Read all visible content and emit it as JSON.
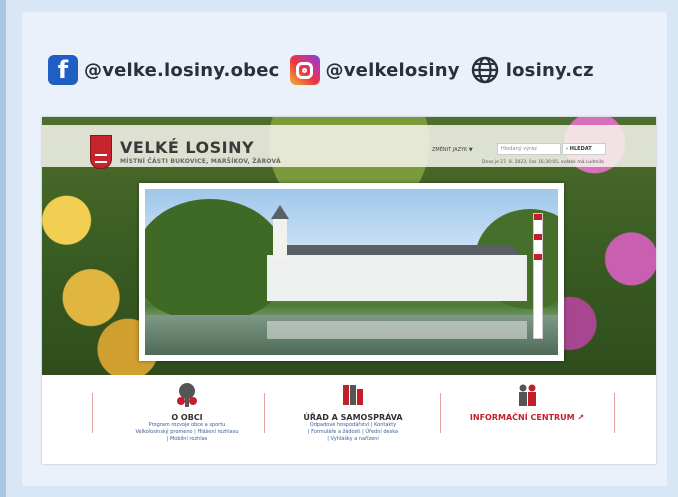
{
  "social": {
    "facebook": {
      "icon": "facebook-icon",
      "handle": "@velke.losiny.obec",
      "color": "#1f5fc4"
    },
    "instagram": {
      "icon": "instagram-icon",
      "handle": "@velkelosiny"
    },
    "web": {
      "icon": "globe-icon",
      "handle": "losiny.cz"
    }
  },
  "site": {
    "title": "VELKÉ LOSINY",
    "subtitle": "MÍSTNÍ ČÁSTI BUKOVICE, MARŠÍKOV, ŽÁROVÁ",
    "language": "ZMĚNIT JAZYK ▼",
    "search_placeholder": "Hledaný výraz",
    "search_button": "› HLEDAT",
    "date_line": "Dnes je 27. 8. 2023, čas 16:30:05, svátek má Lud­mila",
    "menu": [
      {
        "title": "O OBCI",
        "links": [
          "Program rozvoje obce a sportu",
          "Velkolosinský promeno  |  Hlášení rozhlasu",
          "|  Mobilní rozhlas"
        ]
      },
      {
        "title": "ÚŘAD A SAMOSPRÁVA",
        "links": [
          "Odpadové hospodářství  |  Kontakty",
          "|  Formuláře a žádosti  |  Úřední deska",
          "|  Vyhlášky a nařízení"
        ]
      },
      {
        "title": "INFORMAČNÍ CENTRUM ↗",
        "links": []
      }
    ]
  },
  "colors": {
    "accent": "#c31f2b",
    "link": "#3a5d9b"
  }
}
